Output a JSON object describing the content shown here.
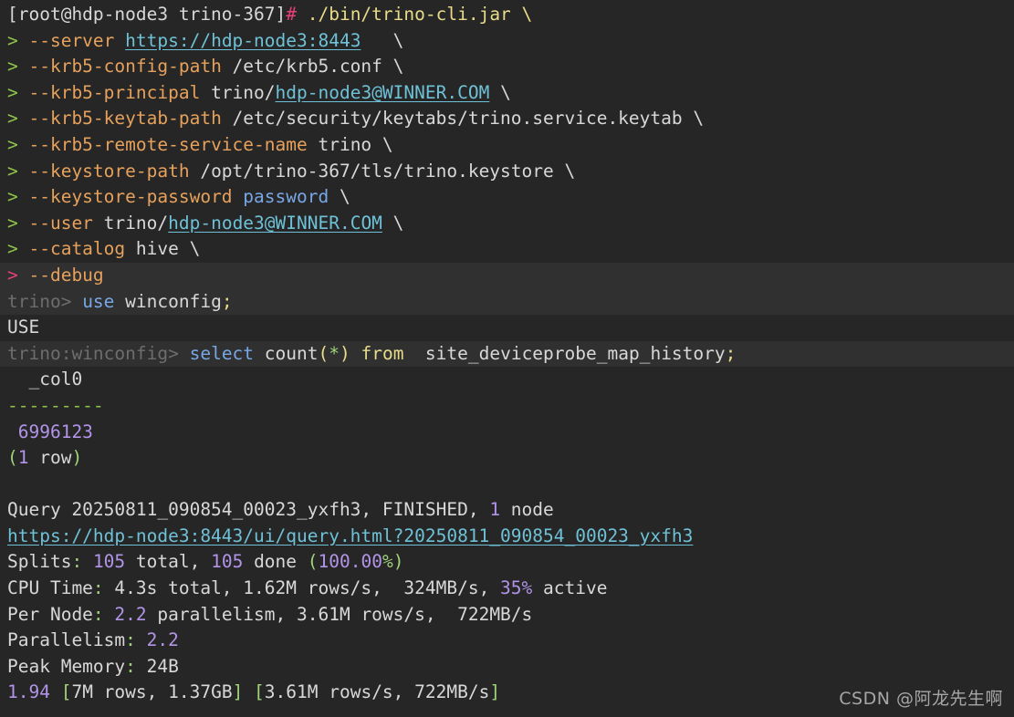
{
  "colors": {
    "background": "#262626",
    "highlight_row": "#303030",
    "default_text": "#d8d8d8",
    "prompt_hash": "#e5407a",
    "option_flag": "#e6a15c",
    "command_text": "#e8dc8a",
    "number": "#b294e8",
    "keyword": "#79a7e6",
    "link": "#6ec1d6",
    "dim_prompt": "#6d6d6d"
  },
  "terminal": {
    "lines": [
      {
        "id": "cmd-launch",
        "segments": [
          {
            "text": "[root@hdp-node3 trino-367]",
            "color": "default"
          },
          {
            "text": "# ",
            "color": "pink"
          },
          {
            "text": "./bin/trino-cli.jar \\",
            "color": "yellow"
          }
        ]
      },
      {
        "id": "opt-server",
        "segments": [
          {
            "text": "> ",
            "color": "green"
          },
          {
            "text": "--server ",
            "color": "orange"
          },
          {
            "text": "https://hdp-node3:8443",
            "color": "link",
            "link": true
          },
          {
            "text": "   \\",
            "color": "default"
          }
        ]
      },
      {
        "id": "opt-krb5-config-path",
        "segments": [
          {
            "text": "> ",
            "color": "green"
          },
          {
            "text": "--krb5-config-path ",
            "color": "orange"
          },
          {
            "text": "/etc/krb5.conf \\",
            "color": "default"
          }
        ]
      },
      {
        "id": "opt-krb5-principal",
        "segments": [
          {
            "text": "> ",
            "color": "green"
          },
          {
            "text": "--krb5-principal ",
            "color": "orange"
          },
          {
            "text": "trino/",
            "color": "default"
          },
          {
            "text": "hdp-node3@WINNER.COM",
            "color": "link",
            "link": true
          },
          {
            "text": " \\",
            "color": "default"
          }
        ]
      },
      {
        "id": "opt-krb5-keytab-path",
        "segments": [
          {
            "text": "> ",
            "color": "green"
          },
          {
            "text": "--krb5-keytab-path ",
            "color": "orange"
          },
          {
            "text": "/etc/security/keytabs/trino.service.keytab \\",
            "color": "default"
          }
        ]
      },
      {
        "id": "opt-krb5-remote-service-name",
        "segments": [
          {
            "text": "> ",
            "color": "green"
          },
          {
            "text": "--krb5-remote-service-name ",
            "color": "orange"
          },
          {
            "text": "trino \\",
            "color": "default"
          }
        ]
      },
      {
        "id": "opt-keystore-path",
        "segments": [
          {
            "text": "> ",
            "color": "green"
          },
          {
            "text": "--keystore-path ",
            "color": "orange"
          },
          {
            "text": "/opt/trino-367/tls/trino.keystore \\",
            "color": "default"
          }
        ]
      },
      {
        "id": "opt-keystore-password",
        "segments": [
          {
            "text": "> ",
            "color": "green"
          },
          {
            "text": "--keystore-password ",
            "color": "orange"
          },
          {
            "text": "password",
            "color": "blue"
          },
          {
            "text": " \\",
            "color": "default"
          }
        ]
      },
      {
        "id": "opt-user",
        "segments": [
          {
            "text": "> ",
            "color": "green"
          },
          {
            "text": "--user ",
            "color": "orange"
          },
          {
            "text": "trino/",
            "color": "default"
          },
          {
            "text": "hdp-node3@WINNER.COM",
            "color": "link",
            "link": true
          },
          {
            "text": " \\",
            "color": "default"
          }
        ]
      },
      {
        "id": "opt-catalog",
        "segments": [
          {
            "text": "> ",
            "color": "green"
          },
          {
            "text": "--catalog ",
            "color": "orange"
          },
          {
            "text": "hive \\",
            "color": "default"
          }
        ]
      },
      {
        "id": "opt-debug",
        "highlight": true,
        "segments": [
          {
            "text": "> ",
            "color": "pink"
          },
          {
            "text": "--debug",
            "color": "orange"
          }
        ]
      },
      {
        "id": "trino-use",
        "highlight": true,
        "segments": [
          {
            "text": "trino> ",
            "color": "gray"
          },
          {
            "text": "use ",
            "color": "blue"
          },
          {
            "text": "winconfig",
            "color": "default"
          },
          {
            "text": ";",
            "color": "yellow"
          }
        ]
      },
      {
        "id": "out-use",
        "segments": [
          {
            "text": "USE",
            "color": "default"
          }
        ]
      },
      {
        "id": "trino-select",
        "highlight": true,
        "segments": [
          {
            "text": "trino:winconfig> ",
            "color": "gray"
          },
          {
            "text": "select ",
            "color": "blue"
          },
          {
            "text": "count",
            "color": "default"
          },
          {
            "text": "(",
            "color": "yellow"
          },
          {
            "text": "*",
            "color": "ltgreen"
          },
          {
            "text": ") ",
            "color": "yellow"
          },
          {
            "text": "from ",
            "color": "yellow"
          },
          {
            "text": " site_deviceprobe_map_history",
            "color": "default"
          },
          {
            "text": ";",
            "color": "yellow"
          }
        ]
      },
      {
        "id": "out-col-header",
        "segments": [
          {
            "text": "  _col0",
            "color": "default"
          }
        ]
      },
      {
        "id": "out-col-divider",
        "segments": [
          {
            "text": "---------",
            "color": "green"
          }
        ]
      },
      {
        "id": "out-value",
        "segments": [
          {
            "text": " 6996123",
            "color": "purple"
          }
        ]
      },
      {
        "id": "out-row-count",
        "segments": [
          {
            "text": "(",
            "color": "ltgreen"
          },
          {
            "text": "1",
            "color": "purple"
          },
          {
            "text": " row",
            "color": "default"
          },
          {
            "text": ")",
            "color": "ltgreen"
          }
        ]
      },
      {
        "id": "blank",
        "segments": [
          {
            "text": " ",
            "color": "default"
          }
        ]
      },
      {
        "id": "out-query",
        "segments": [
          {
            "text": "Query 20250811_090854_00023_yxfh3, FINISHED, ",
            "color": "default"
          },
          {
            "text": "1",
            "color": "purple"
          },
          {
            "text": " node",
            "color": "default"
          }
        ]
      },
      {
        "id": "out-query-url",
        "segments": [
          {
            "text": "https://hdp-node3:8443/ui/query.html?20250811_090854_00023_yxfh3",
            "color": "link",
            "link": true
          }
        ]
      },
      {
        "id": "out-splits",
        "segments": [
          {
            "text": "Splits",
            "color": "default"
          },
          {
            "text": ": ",
            "color": "ltgreen"
          },
          {
            "text": "105",
            "color": "purple"
          },
          {
            "text": " total, ",
            "color": "default"
          },
          {
            "text": "105",
            "color": "purple"
          },
          {
            "text": " done ",
            "color": "default"
          },
          {
            "text": "(",
            "color": "ltgreen"
          },
          {
            "text": "100.00",
            "color": "purple"
          },
          {
            "text": "%)",
            "color": "ltgreen"
          }
        ]
      },
      {
        "id": "out-cpu-time",
        "segments": [
          {
            "text": "CPU Time",
            "color": "default"
          },
          {
            "text": ": ",
            "color": "ltgreen"
          },
          {
            "text": "4.3s total, 1.62M rows/s,  324MB/s, ",
            "color": "default"
          },
          {
            "text": "35%",
            "color": "purple"
          },
          {
            "text": " active",
            "color": "default"
          }
        ]
      },
      {
        "id": "out-per-node",
        "segments": [
          {
            "text": "Per Node",
            "color": "default"
          },
          {
            "text": ": ",
            "color": "ltgreen"
          },
          {
            "text": "2.2",
            "color": "purple"
          },
          {
            "text": " parallelism, 3.61M rows/s,  722MB/s",
            "color": "default"
          }
        ]
      },
      {
        "id": "out-parallelism",
        "segments": [
          {
            "text": "Parallelism",
            "color": "default"
          },
          {
            "text": ": ",
            "color": "ltgreen"
          },
          {
            "text": "2.2",
            "color": "purple"
          }
        ]
      },
      {
        "id": "out-peak-memory",
        "segments": [
          {
            "text": "Peak Memory",
            "color": "default"
          },
          {
            "text": ": ",
            "color": "ltgreen"
          },
          {
            "text": "24B",
            "color": "default"
          }
        ]
      },
      {
        "id": "out-progress",
        "segments": [
          {
            "text": "1.94",
            "color": "purple"
          },
          {
            "text": " [",
            "color": "ltgreen"
          },
          {
            "text": "7M rows, 1.37GB",
            "color": "default"
          },
          {
            "text": "] [",
            "color": "ltgreen"
          },
          {
            "text": "3.61M rows/s, 722MB/s",
            "color": "default"
          },
          {
            "text": "]",
            "color": "ltgreen"
          }
        ]
      }
    ]
  },
  "watermark": {
    "text": "CSDN @阿龙先生啊"
  }
}
